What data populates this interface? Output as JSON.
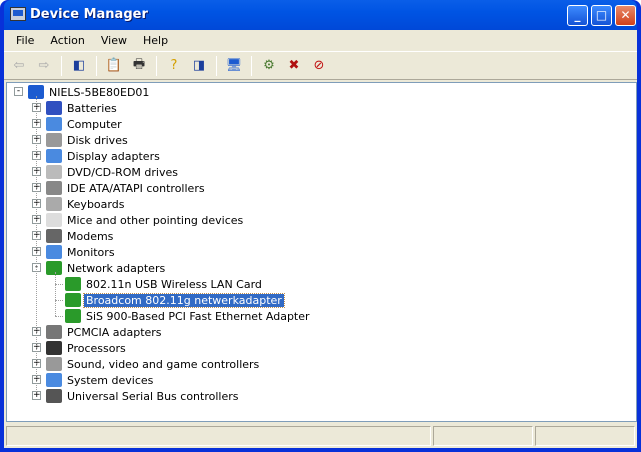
{
  "window": {
    "title": "Device Manager"
  },
  "menu": [
    "File",
    "Action",
    "View",
    "Help"
  ],
  "toolbar": [
    {
      "name": "back-icon",
      "glyph": "⇦",
      "color": "#aaa"
    },
    {
      "name": "forward-icon",
      "glyph": "⇨",
      "color": "#aaa"
    },
    {
      "sep": true
    },
    {
      "name": "show-hide-console-tree-icon",
      "glyph": "◧",
      "color": "#1c3f9c"
    },
    {
      "sep": true
    },
    {
      "name": "properties-icon",
      "glyph": "📋",
      "color": "#333"
    },
    {
      "name": "print-icon",
      "glyph": "🖶",
      "color": "#333"
    },
    {
      "sep": true
    },
    {
      "name": "help-icon",
      "glyph": "?",
      "color": "#d4a000"
    },
    {
      "name": "show-hide-action-pane-icon",
      "glyph": "◨",
      "color": "#1c3f9c"
    },
    {
      "sep": true
    },
    {
      "name": "scan-hardware-icon",
      "glyph": "🖥",
      "color": "#1c5bd0"
    },
    {
      "sep": true
    },
    {
      "name": "update-driver-icon",
      "glyph": "⚙",
      "color": "#4a7a30"
    },
    {
      "name": "uninstall-icon",
      "glyph": "✖",
      "color": "#b01010"
    },
    {
      "name": "disable-icon",
      "glyph": "⊘",
      "color": "#c01010"
    }
  ],
  "tree": {
    "root": "NIELS-5BE80ED01",
    "categories": [
      {
        "label": "Batteries",
        "color": "#3050c0"
      },
      {
        "label": "Computer",
        "color": "#4a8ae0"
      },
      {
        "label": "Disk drives",
        "color": "#999"
      },
      {
        "label": "Display adapters",
        "color": "#4a8ae0"
      },
      {
        "label": "DVD/CD-ROM drives",
        "color": "#bbb"
      },
      {
        "label": "IDE ATA/ATAPI controllers",
        "color": "#888"
      },
      {
        "label": "Keyboards",
        "color": "#aaa"
      },
      {
        "label": "Mice and other pointing devices",
        "color": "#ddd"
      },
      {
        "label": "Modems",
        "color": "#666"
      },
      {
        "label": "Monitors",
        "color": "#4a8ae0"
      },
      {
        "label": "Network adapters",
        "color": "#2a9a2a",
        "expanded": true,
        "children": [
          {
            "label": "802.11n USB Wireless LAN Card"
          },
          {
            "label": "Broadcom 802.11g netwerkadapter",
            "selected": true
          },
          {
            "label": "SiS 900-Based PCI Fast Ethernet Adapter"
          }
        ]
      },
      {
        "label": "PCMCIA adapters",
        "color": "#777"
      },
      {
        "label": "Processors",
        "color": "#333"
      },
      {
        "label": "Sound, video and game controllers",
        "color": "#999"
      },
      {
        "label": "System devices",
        "color": "#4a8ae0"
      },
      {
        "label": "Universal Serial Bus controllers",
        "color": "#555"
      }
    ]
  }
}
